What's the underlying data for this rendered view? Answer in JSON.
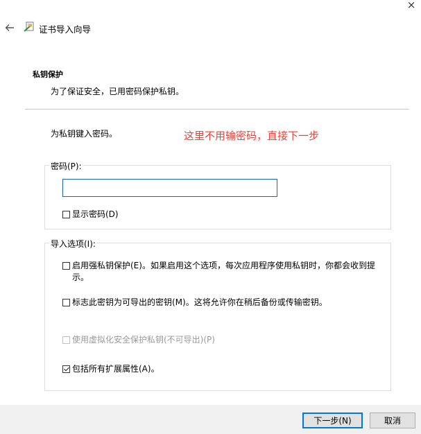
{
  "window": {
    "close_glyph": "×"
  },
  "header": {
    "title": "证书导入向导",
    "back_icon": "arrow-left-icon",
    "wizard_icon": "certificate-wizard-icon"
  },
  "section": {
    "title": "私钥保护",
    "description": "为了保证安全，已用密码保护私钥。"
  },
  "prompt": "为私钥键入密码。",
  "annotation": "这里不用输密码，直接下一步",
  "password_group": {
    "label": "密码(P):",
    "input_value": "",
    "show_password": {
      "label": "显示密码(D)",
      "checked": false
    }
  },
  "import_options": {
    "label": "导入选项(I):",
    "options": [
      {
        "label": "启用强私钥保护(E)。如果启用这个选项，每次应用程序使用私钥时，你都会收到提示。",
        "checked": false,
        "enabled": true
      },
      {
        "label": "标志此密钥为可导出的密钥(M)。这将允许你在稍后备份或传输密钥。",
        "checked": false,
        "enabled": true
      },
      {
        "label": "使用虚拟化安全保护私钥(不可导出)(P)",
        "checked": false,
        "enabled": false
      },
      {
        "label": "包括所有扩展属性(A)。",
        "checked": true,
        "enabled": true
      }
    ]
  },
  "footer": {
    "next_label": "下一步(N)",
    "cancel_label": "取消"
  }
}
